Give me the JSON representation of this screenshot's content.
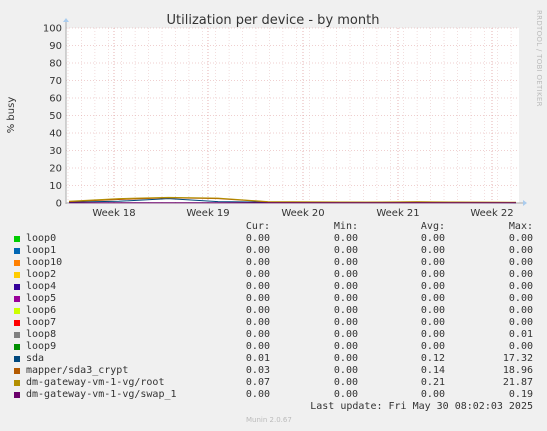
{
  "chart_data": {
    "type": "line",
    "title": "Utilization per device - by month",
    "ylabel": "% busy",
    "ylim": [
      0,
      100
    ],
    "yticks": [
      "0",
      "10",
      "20",
      "30",
      "40",
      "50",
      "60",
      "70",
      "80",
      "90",
      "100"
    ],
    "xticks": [
      "Week 18",
      "Week 19",
      "Week 20",
      "Week 21",
      "Week 22"
    ],
    "watermark": "RRDTOOL / TOBI OETIKER",
    "grid": true,
    "series": [
      {
        "name": "loop0",
        "color": "#00cc00"
      },
      {
        "name": "loop1",
        "color": "#0066b3"
      },
      {
        "name": "loop10",
        "color": "#ff8000"
      },
      {
        "name": "loop2",
        "color": "#ffcc00"
      },
      {
        "name": "loop4",
        "color": "#330099"
      },
      {
        "name": "loop5",
        "color": "#990099"
      },
      {
        "name": "loop6",
        "color": "#ccff00"
      },
      {
        "name": "loop7",
        "color": "#ff0000"
      },
      {
        "name": "loop8",
        "color": "#808080"
      },
      {
        "name": "loop9",
        "color": "#008f00"
      },
      {
        "name": "sda",
        "color": "#00487d",
        "values": [
          0.5,
          1.0,
          2.5,
          0.8,
          0.5,
          0.4,
          0.3,
          0.4,
          0.3,
          0.2
        ]
      },
      {
        "name": "mapper/sda3_crypt",
        "color": "#b35a00",
        "values": [
          0.8,
          2.0,
          3.0,
          2.5,
          0.6,
          0.5,
          0.4,
          0.6,
          0.4,
          0.3
        ]
      },
      {
        "name": "dm-gateway-vm-1-vg/root",
        "color": "#b38f00",
        "values": [
          1.0,
          2.5,
          3.2,
          2.8,
          0.8,
          0.6,
          0.5,
          0.7,
          0.5,
          0.4
        ]
      },
      {
        "name": "dm-gateway-vm-1-vg/swap_1",
        "color": "#6b006b",
        "values": [
          0.1,
          0.1,
          0.2,
          0.1,
          0.1,
          0.1,
          0.1,
          0.1,
          0.1,
          0.1
        ]
      }
    ]
  },
  "legend": {
    "headers": {
      "cur": "Cur:",
      "min": "Min:",
      "avg": "Avg:",
      "max": "Max:"
    },
    "rows": [
      {
        "name": "loop0",
        "color": "#00cc00",
        "cur": "0.00",
        "min": "0.00",
        "avg": "0.00",
        "max": "0.00"
      },
      {
        "name": "loop1",
        "color": "#0066b3",
        "cur": "0.00",
        "min": "0.00",
        "avg": "0.00",
        "max": "0.00"
      },
      {
        "name": "loop10",
        "color": "#ff8000",
        "cur": "0.00",
        "min": "0.00",
        "avg": "0.00",
        "max": "0.00"
      },
      {
        "name": "loop2",
        "color": "#ffcc00",
        "cur": "0.00",
        "min": "0.00",
        "avg": "0.00",
        "max": "0.00"
      },
      {
        "name": "loop4",
        "color": "#330099",
        "cur": "0.00",
        "min": "0.00",
        "avg": "0.00",
        "max": "0.00"
      },
      {
        "name": "loop5",
        "color": "#990099",
        "cur": "0.00",
        "min": "0.00",
        "avg": "0.00",
        "max": "0.00"
      },
      {
        "name": "loop6",
        "color": "#ccff00",
        "cur": "0.00",
        "min": "0.00",
        "avg": "0.00",
        "max": "0.00"
      },
      {
        "name": "loop7",
        "color": "#ff0000",
        "cur": "0.00",
        "min": "0.00",
        "avg": "0.00",
        "max": "0.00"
      },
      {
        "name": "loop8",
        "color": "#808080",
        "cur": "0.00",
        "min": "0.00",
        "avg": "0.00",
        "max": "0.01"
      },
      {
        "name": "loop9",
        "color": "#008f00",
        "cur": "0.00",
        "min": "0.00",
        "avg": "0.00",
        "max": "0.00"
      },
      {
        "name": "sda",
        "color": "#00487d",
        "cur": "0.01",
        "min": "0.00",
        "avg": "0.12",
        "max": "17.32"
      },
      {
        "name": "mapper/sda3_crypt",
        "color": "#b35a00",
        "cur": "0.03",
        "min": "0.00",
        "avg": "0.14",
        "max": "18.96"
      },
      {
        "name": "dm-gateway-vm-1-vg/root",
        "color": "#b38f00",
        "cur": "0.07",
        "min": "0.00",
        "avg": "0.21",
        "max": "21.87"
      },
      {
        "name": "dm-gateway-vm-1-vg/swap_1",
        "color": "#6b006b",
        "cur": "0.00",
        "min": "0.00",
        "avg": "0.00",
        "max": "0.19"
      }
    ]
  },
  "footer": {
    "last_update": "Last update: Fri May 30 08:02:03 2025",
    "munin": "Munin 2.0.67"
  }
}
